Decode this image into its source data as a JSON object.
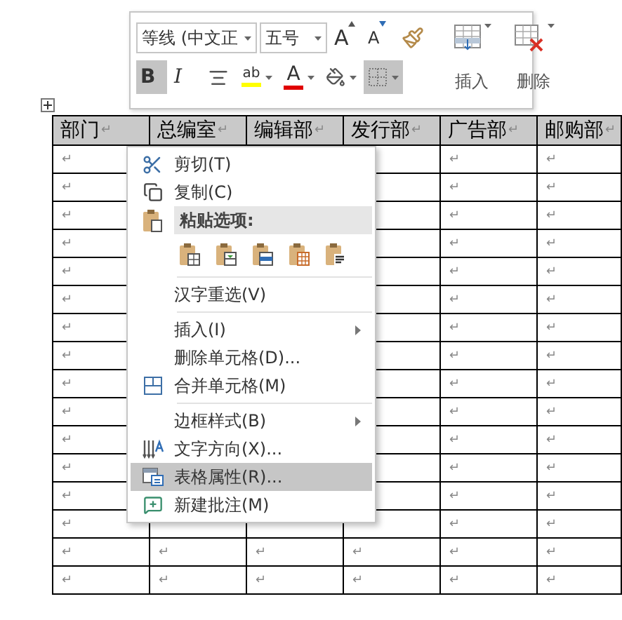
{
  "toolbar": {
    "font": {
      "value": "等线 (中文正"
    },
    "size": {
      "value": "五号"
    },
    "row_1": [
      {
        "kind": "grow",
        "label": "A"
      },
      {
        "kind": "shrink",
        "label": "A"
      },
      {
        "kind": "painter"
      }
    ],
    "row_2": [
      {
        "kind": "bold",
        "label": "B",
        "selected": true,
        "dropdown": false
      },
      {
        "kind": "italic",
        "label": "I",
        "selected": false,
        "dropdown": false
      },
      {
        "kind": "align",
        "selected": false,
        "dropdown": false
      },
      {
        "kind": "highlight",
        "label": "ab",
        "color": "#ffff00",
        "selected": false,
        "dropdown": true
      },
      {
        "kind": "font-color",
        "label": "A",
        "color": "#e00000",
        "selected": false,
        "dropdown": true
      },
      {
        "kind": "shading",
        "selected": false,
        "dropdown": true
      },
      {
        "kind": "borders",
        "selected": true,
        "dropdown": true
      }
    ],
    "table_buttons": [
      {
        "kind": "insert",
        "label": "插入"
      },
      {
        "kind": "delete",
        "label": "删除"
      }
    ]
  },
  "table": {
    "columns": [
      {
        "label": "部门",
        "mark": "↵"
      },
      {
        "label": "总编室",
        "mark": "↵"
      },
      {
        "label": "编辑部",
        "mark": "↵"
      },
      {
        "label": "发行部",
        "mark": "↵"
      },
      {
        "label": "广告部",
        "mark": "↵"
      },
      {
        "label": "邮购部",
        "mark": "↵"
      }
    ],
    "rows": [
      {
        "column_1": "↵",
        "column_5": "↵",
        "column_6": "↵"
      },
      {
        "column_1": "↵",
        "column_5": "↵",
        "column_6": "↵"
      },
      {
        "column_1": "↵",
        "column_5": "↵",
        "column_6": "↵"
      },
      {
        "column_1": "↵",
        "column_5": "↵",
        "column_6": "↵"
      },
      {
        "column_1": "↵",
        "column_5": "↵",
        "column_6": "↵"
      },
      {
        "column_1": "↵",
        "column_5": "↵",
        "column_6": "↵"
      },
      {
        "column_1": "↵",
        "column_5": "↵",
        "column_6": "↵"
      },
      {
        "column_1": "↵",
        "column_5": "↵",
        "column_6": "↵"
      },
      {
        "column_1": "↵",
        "column_5": "↵",
        "column_6": "↵"
      },
      {
        "column_1": "↵",
        "column_5": "↵",
        "column_6": "↵"
      },
      {
        "column_1": "↵",
        "column_5": "↵",
        "column_6": "↵"
      },
      {
        "column_1": "↵",
        "column_5": "↵",
        "column_6": "↵"
      },
      {
        "column_1": "↵",
        "column_5": "↵",
        "column_6": "↵"
      },
      {
        "column_1": "↵",
        "column_5": "↵",
        "column_6": "↵"
      },
      {
        "column_1": "↵",
        "column_2": "↵",
        "column_3": "↵",
        "column_4": "↵",
        "column_5": "↵",
        "column_6": "↵"
      },
      {
        "column_1": "↵",
        "column_2": "↵",
        "column_3": "↵",
        "column_4": "↵",
        "column_5": "↵",
        "column_6": "↵"
      }
    ]
  },
  "context_menu": {
    "items": [
      {
        "kind": "item",
        "label": "剪切(T)",
        "submenu": false,
        "selected": false
      },
      {
        "kind": "item",
        "label": "复制(C)",
        "submenu": false,
        "selected": false
      },
      {
        "kind": "header",
        "label": "粘贴选项:"
      },
      {
        "kind": "paste-options",
        "options": [
          {
            "kind": "keep-source"
          },
          {
            "kind": "merge"
          },
          {
            "kind": "nest"
          },
          {
            "kind": "rows"
          },
          {
            "kind": "text-only"
          }
        ]
      },
      {
        "kind": "separator"
      },
      {
        "kind": "item",
        "label": "汉字重选(V)",
        "submenu": false,
        "selected": false
      },
      {
        "kind": "separator"
      },
      {
        "kind": "item",
        "label": "插入(I)",
        "submenu": true,
        "selected": false
      },
      {
        "kind": "item",
        "label": "删除单元格(D)...",
        "submenu": false,
        "selected": false
      },
      {
        "kind": "item",
        "label": "合并单元格(M)",
        "submenu": false,
        "selected": false
      },
      {
        "kind": "separator"
      },
      {
        "kind": "item",
        "label": "边框样式(B)",
        "submenu": true,
        "selected": false
      },
      {
        "kind": "item",
        "label": "文字方向(X)...",
        "submenu": false,
        "selected": false
      },
      {
        "kind": "item",
        "label": "表格属性(R)...",
        "submenu": false,
        "selected": true
      },
      {
        "kind": "item",
        "label": "新建批注(M)",
        "submenu": false,
        "selected": false
      }
    ]
  }
}
